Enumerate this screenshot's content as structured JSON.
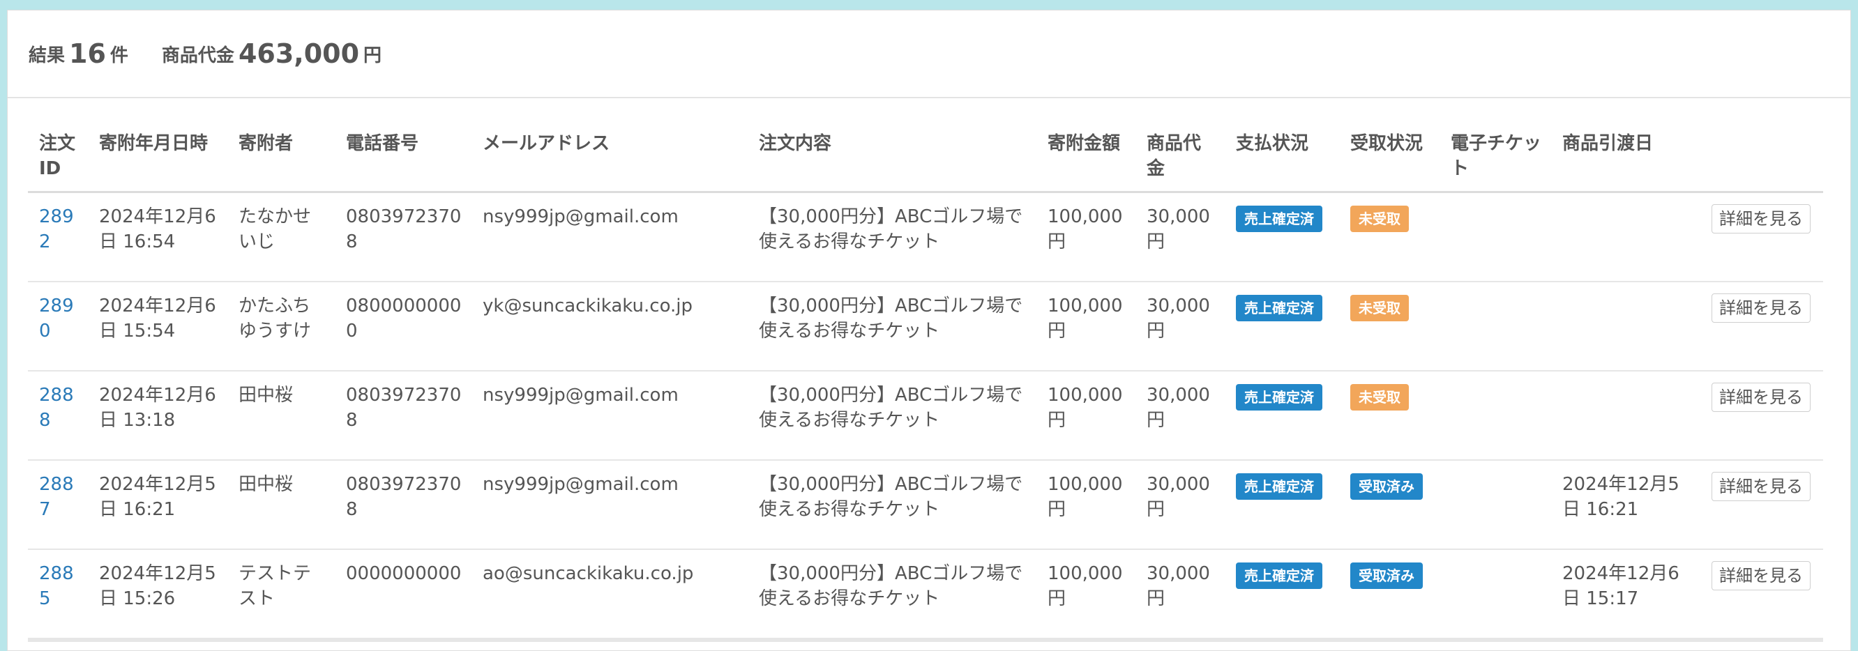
{
  "summary": {
    "results_label": "結果",
    "results_count": "16",
    "results_unit": "件",
    "amount_label": "商品代金",
    "amount_value": "463,000",
    "amount_unit": "円"
  },
  "columns": [
    "注文ID",
    "寄附年月日時",
    "寄附者",
    "電話番号",
    "メールアドレス",
    "注文内容",
    "寄附金額",
    "商品代金",
    "支払状況",
    "受取状況",
    "電子チケット",
    "商品引渡日",
    ""
  ],
  "colors": {
    "link": "#2a7ab8",
    "badge_blue": "#2287c9",
    "badge_orange": "#f2a65a"
  },
  "rows": [
    {
      "id": "2892",
      "date": "2024年12月6日 16:54",
      "donor": "たなかせいじ",
      "phone": "08039723708",
      "email": "nsy999jp@gmail.com",
      "content": "【30,000円分】ABCゴルフ場で使えるお得なチケット",
      "donation": "100,000円",
      "price": "30,000円",
      "payment": "売上確定済",
      "receipt": "未受取",
      "eticket": "",
      "delivery": "",
      "button": "詳細を見る"
    },
    {
      "id": "2890",
      "date": "2024年12月6日 15:54",
      "donor": "かたふちゆうすけ",
      "phone": "08000000000",
      "email": "yk@suncackikaku.co.jp",
      "content": "【30,000円分】ABCゴルフ場で使えるお得なチケット",
      "donation": "100,000円",
      "price": "30,000円",
      "payment": "売上確定済",
      "receipt": "未受取",
      "eticket": "",
      "delivery": "",
      "button": "詳細を見る"
    },
    {
      "id": "2888",
      "date": "2024年12月6日 13:18",
      "donor": "田中桜",
      "phone": "08039723708",
      "email": "nsy999jp@gmail.com",
      "content": "【30,000円分】ABCゴルフ場で使えるお得なチケット",
      "donation": "100,000円",
      "price": "30,000円",
      "payment": "売上確定済",
      "receipt": "未受取",
      "eticket": "",
      "delivery": "",
      "button": "詳細を見る"
    },
    {
      "id": "2887",
      "date": "2024年12月5日 16:21",
      "donor": "田中桜",
      "phone": "08039723708",
      "email": "nsy999jp@gmail.com",
      "content": "【30,000円分】ABCゴルフ場で使えるお得なチケット",
      "donation": "100,000円",
      "price": "30,000円",
      "payment": "売上確定済",
      "receipt": "受取済み",
      "eticket": "",
      "delivery": "2024年12月5日 16:21",
      "button": "詳細を見る"
    },
    {
      "id": "2885",
      "date": "2024年12月5日 15:26",
      "donor": "テストテスト",
      "phone": "0000000000",
      "email": "ao@suncackikaku.co.jp",
      "content": "【30,000円分】ABCゴルフ場で使えるお得なチケット",
      "donation": "100,000円",
      "price": "30,000円",
      "payment": "売上確定済",
      "receipt": "受取済み",
      "eticket": "",
      "delivery": "2024年12月6日 15:17",
      "button": "詳細を見る"
    }
  ]
}
